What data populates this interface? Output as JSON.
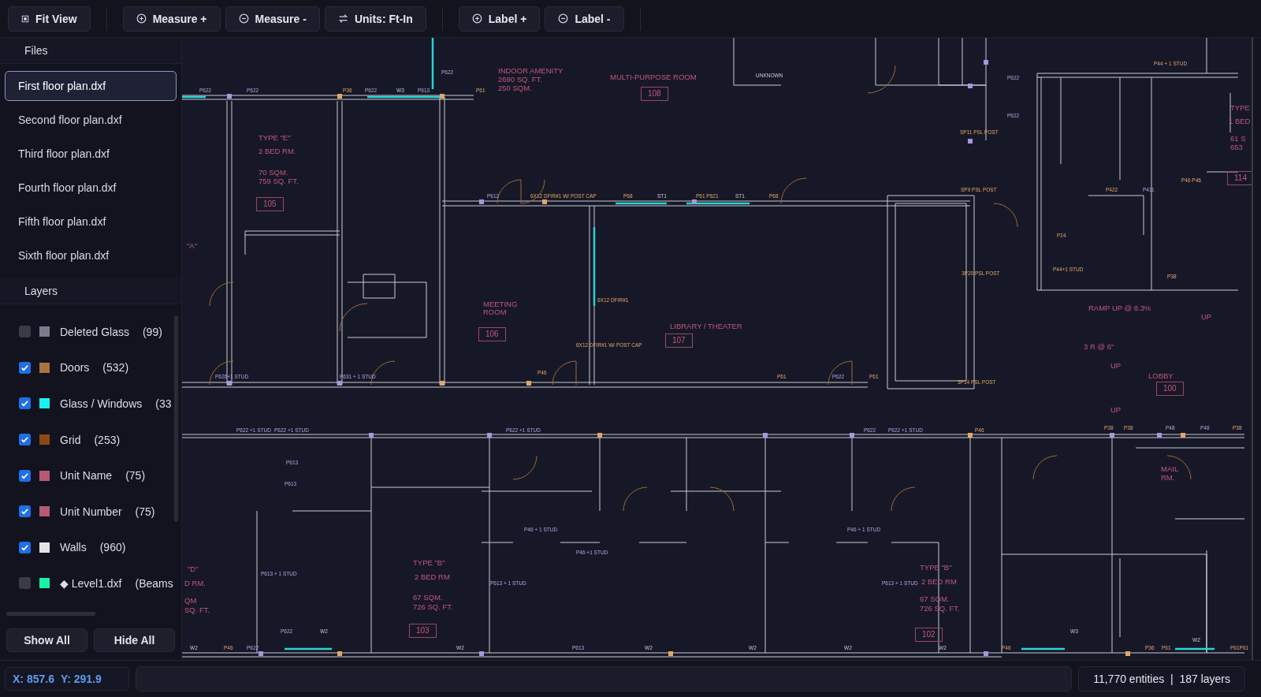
{
  "toolbar": {
    "groups": [
      [
        {
          "label": "Fit View"
        }
      ],
      [
        {
          "label": "Measure +"
        },
        {
          "label": "Measure -"
        },
        {
          "label": "Units: Ft-In"
        }
      ],
      [
        {
          "label": "Label +"
        },
        {
          "label": "Label -"
        }
      ]
    ]
  },
  "sidebar": {
    "files_title": "Files",
    "files": [
      {
        "name": "First floor plan.dxf",
        "selected": true
      },
      {
        "name": "Second floor plan.dxf",
        "selected": false
      },
      {
        "name": "Third floor plan.dxf",
        "selected": false
      },
      {
        "name": "Fourth floor plan.dxf",
        "selected": false
      },
      {
        "name": "Fifth floor plan.dxf",
        "selected": false
      },
      {
        "name": "Sixth floor plan.dxf",
        "selected": false
      }
    ],
    "layers_title": "Layers",
    "layers": [
      {
        "name": "Deleted Glass",
        "count": "(99)",
        "checked": false,
        "color": "#7b7d8e"
      },
      {
        "name": "Doors",
        "count": "(532)",
        "checked": true,
        "color": "#a9733f"
      },
      {
        "name": "Glass / Windows",
        "count": "(33",
        "checked": true,
        "color": "#19f2f2"
      },
      {
        "name": "Grid",
        "count": "(253)",
        "checked": true,
        "color": "#8c4a12"
      },
      {
        "name": "Unit Name",
        "count": "(75)",
        "checked": true,
        "color": "#b85a72"
      },
      {
        "name": "Unit Number",
        "count": "(75)",
        "checked": true,
        "color": "#b85a72"
      },
      {
        "name": "Walls",
        "count": "(960)",
        "checked": true,
        "color": "#e4e4e8"
      },
      {
        "name": "◆ Level1.dxf",
        "count": "(Beams",
        "checked": false,
        "color": "#19f2a6"
      }
    ],
    "buttons": [
      "Show All",
      "Hide All"
    ]
  },
  "plan": {
    "labels": [
      {
        "text": "P44 + 1 STUD",
        "kind": "post"
      },
      {
        "text": "INDOOR AMENITY",
        "kind": "room"
      },
      {
        "text": "2690 SQ. FT.",
        "kind": "room"
      },
      {
        "text": "250 SQM.",
        "kind": "room"
      },
      {
        "text": "MULTI-PURPOSE ROOM",
        "kind": "room"
      },
      {
        "text": "108",
        "kind": "unit"
      },
      {
        "text": "TYPE \"E\"",
        "kind": "room"
      },
      {
        "text": "2 BED RM.",
        "kind": "room"
      },
      {
        "text": "70 SQM.",
        "kind": "room"
      },
      {
        "text": "759 SQ. FT.",
        "kind": "room"
      },
      {
        "text": "105",
        "kind": "unit"
      },
      {
        "text": "MEETING",
        "kind": "room"
      },
      {
        "text": "ROOM",
        "kind": "room"
      },
      {
        "text": "106",
        "kind": "unit"
      },
      {
        "text": "LIBRARY / THEATER",
        "kind": "room"
      },
      {
        "text": "107",
        "kind": "unit"
      },
      {
        "text": "LOBBY",
        "kind": "room"
      },
      {
        "text": "100",
        "kind": "unit"
      },
      {
        "text": "RAMP UP @ 8.3%",
        "kind": "room"
      },
      {
        "text": "UP",
        "kind": "room"
      },
      {
        "text": "3 R @ 6\"",
        "kind": "room"
      },
      {
        "text": "UP",
        "kind": "room"
      },
      {
        "text": "UP",
        "kind": "room"
      },
      {
        "text": "TYPE",
        "kind": "room"
      },
      {
        "text": "1 BED",
        "kind": "room"
      },
      {
        "text": "61 S",
        "kind": "room"
      },
      {
        "text": "653",
        "kind": "room"
      },
      {
        "text": "114",
        "kind": "unit"
      },
      {
        "text": "TYPE \"B\"",
        "kind": "room"
      },
      {
        "text": "2 BED RM",
        "kind": "room"
      },
      {
        "text": "67 SQM.",
        "kind": "room"
      },
      {
        "text": "726 SQ. FT.",
        "kind": "room"
      },
      {
        "text": "103",
        "kind": "unit"
      },
      {
        "text": "TYPE \"B\"",
        "kind": "room"
      },
      {
        "text": "2 BED RM",
        "kind": "room"
      },
      {
        "text": "67 SQM.",
        "kind": "room"
      },
      {
        "text": "726 SQ. FT.",
        "kind": "room"
      },
      {
        "text": "102",
        "kind": "unit"
      },
      {
        "text": "MAIL",
        "kind": "room"
      },
      {
        "text": "RM.",
        "kind": "room"
      },
      {
        "text": "\"A\"",
        "kind": "room"
      },
      {
        "text": "\"D\"",
        "kind": "room"
      },
      {
        "text": "D RM.",
        "kind": "room"
      },
      {
        "text": "QM",
        "kind": "room"
      },
      {
        "text": "SQ. FT.",
        "kind": "room"
      },
      {
        "text": "UNKNOWN",
        "kind": "note"
      },
      {
        "text": "P622",
        "kind": "tag"
      },
      {
        "text": "P622",
        "kind": "tag"
      },
      {
        "text": "P36",
        "kind": "post"
      },
      {
        "text": "P622",
        "kind": "tag"
      },
      {
        "text": "W3",
        "kind": "note"
      },
      {
        "text": "P613",
        "kind": "tag"
      },
      {
        "text": "P61",
        "kind": "post"
      },
      {
        "text": "P622",
        "kind": "tag"
      },
      {
        "text": "P612",
        "kind": "tag"
      },
      {
        "text": "6X12 DFIR#1 W/ POST CAP",
        "kind": "post"
      },
      {
        "text": "P68",
        "kind": "post"
      },
      {
        "text": "ST1",
        "kind": "note"
      },
      {
        "text": "P61 P621",
        "kind": "post"
      },
      {
        "text": "ST1",
        "kind": "note"
      },
      {
        "text": "P68",
        "kind": "post"
      },
      {
        "text": "6X12 DFIR#1",
        "kind": "post"
      },
      {
        "text": "6X12 DFIR#1 W/ POST CAP",
        "kind": "post"
      },
      {
        "text": "P46",
        "kind": "post"
      },
      {
        "text": "P626+1 STUD",
        "kind": "tag"
      },
      {
        "text": "P631 + 1 STUD",
        "kind": "tag"
      },
      {
        "text": "P61",
        "kind": "post"
      },
      {
        "text": "P622",
        "kind": "tag"
      },
      {
        "text": "P61",
        "kind": "post"
      },
      {
        "text": "SP11 PSL POST",
        "kind": "post"
      },
      {
        "text": "SP9 PSL POST",
        "kind": "post"
      },
      {
        "text": "3P20 PSL POST",
        "kind": "post"
      },
      {
        "text": "3P14 PSL POST",
        "kind": "post"
      },
      {
        "text": "P622",
        "kind": "tag"
      },
      {
        "text": "P622",
        "kind": "tag"
      },
      {
        "text": "P422",
        "kind": "post"
      },
      {
        "text": "P411",
        "kind": "tag"
      },
      {
        "text": "P24",
        "kind": "post"
      },
      {
        "text": "P44+1 STUD",
        "kind": "post"
      },
      {
        "text": "P38",
        "kind": "post"
      },
      {
        "text": "P46 P46",
        "kind": "post"
      },
      {
        "text": "P622 +1 STUD",
        "kind": "tag"
      },
      {
        "text": "P622 +1 STUD",
        "kind": "tag"
      },
      {
        "text": "P622 +1 STUD",
        "kind": "tag"
      },
      {
        "text": "P622",
        "kind": "tag"
      },
      {
        "text": "P622 +1 STUD",
        "kind": "tag"
      },
      {
        "text": "P46",
        "kind": "post"
      },
      {
        "text": "P38",
        "kind": "post"
      },
      {
        "text": "P38",
        "kind": "post"
      },
      {
        "text": "P48",
        "kind": "tag"
      },
      {
        "text": "P48",
        "kind": "tag"
      },
      {
        "text": "P38",
        "kind": "post"
      },
      {
        "text": "P46 + 1 STUD",
        "kind": "tag"
      },
      {
        "text": "P46 +1 STUD",
        "kind": "tag"
      },
      {
        "text": "P46 + 1 STUD",
        "kind": "tag"
      },
      {
        "text": "P613 + 1 STUD",
        "kind": "tag"
      },
      {
        "text": "P613 + 1 STUD",
        "kind": "tag"
      },
      {
        "text": "P613 + 1 STUD",
        "kind": "tag"
      },
      {
        "text": "P613",
        "kind": "tag"
      },
      {
        "text": "P613",
        "kind": "tag"
      },
      {
        "text": "P622",
        "kind": "tag"
      },
      {
        "text": "W2",
        "kind": "note"
      },
      {
        "text": "W2",
        "kind": "note"
      },
      {
        "text": "P46",
        "kind": "post"
      },
      {
        "text": "P622",
        "kind": "tag"
      },
      {
        "text": "W2",
        "kind": "note"
      },
      {
        "text": "P613",
        "kind": "tag"
      },
      {
        "text": "W2",
        "kind": "note"
      },
      {
        "text": "W2",
        "kind": "note"
      },
      {
        "text": "W2",
        "kind": "note"
      },
      {
        "text": "W2",
        "kind": "note"
      },
      {
        "text": "P46",
        "kind": "post"
      },
      {
        "text": "W3",
        "kind": "note"
      },
      {
        "text": "P36",
        "kind": "post"
      },
      {
        "text": "P61",
        "kind": "post"
      },
      {
        "text": "W2",
        "kind": "note"
      },
      {
        "text": "P61P61",
        "kind": "post"
      }
    ]
  },
  "status": {
    "x": "X: 857.6",
    "y": "Y: 291.9",
    "summary": "11,770 entities  |  187 layers"
  }
}
